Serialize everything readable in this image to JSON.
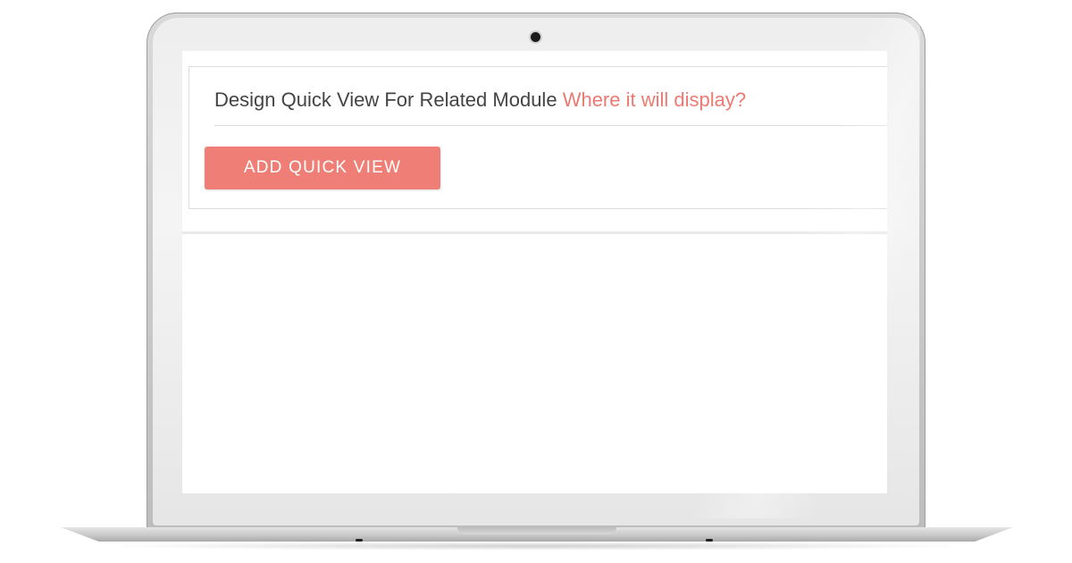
{
  "panel": {
    "heading": "Design Quick View For Related Module",
    "heading_link": "Where it will display?",
    "button_label": "ADD QUICK VIEW"
  },
  "colors": {
    "accent": "#ef7f76",
    "link": "#ec7a72",
    "text": "#444444"
  },
  "icons": [
    "camera-icon"
  ]
}
